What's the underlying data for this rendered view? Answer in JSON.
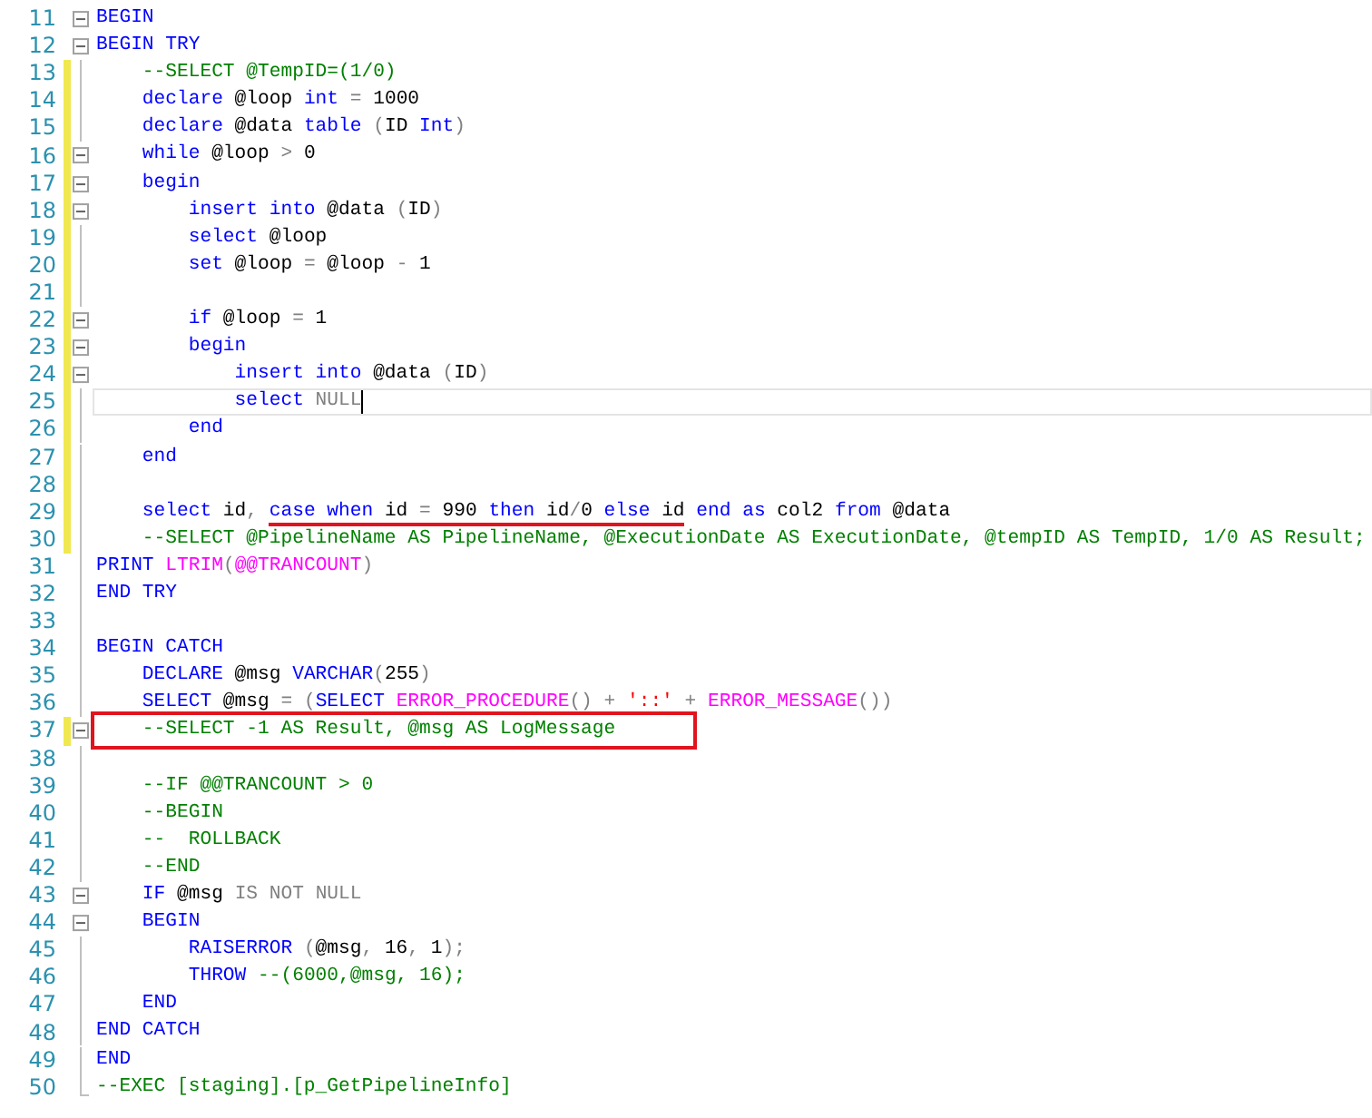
{
  "editor": {
    "lines": [
      {
        "number": "11",
        "changed": false,
        "kind": "start",
        "caret": false,
        "boxed": false,
        "tokens": [
          {
            "kind": "keyword",
            "text": "BEGIN"
          }
        ]
      },
      {
        "number": "12",
        "changed": false,
        "kind": "start",
        "caret": false,
        "boxed": false,
        "tokens": [
          {
            "kind": "keyword",
            "text": "BEGIN TRY"
          }
        ]
      },
      {
        "number": "13",
        "changed": true,
        "kind": "line",
        "caret": false,
        "boxed": false,
        "tokens": [
          {
            "kind": "comment",
            "text": "    --SELECT @TempID=(1/0)"
          }
        ]
      },
      {
        "number": "14",
        "changed": true,
        "kind": "line",
        "caret": false,
        "boxed": false,
        "tokens": [
          {
            "kind": "keyword",
            "text": "    declare"
          },
          {
            "kind": "plain",
            "text": " @loop "
          },
          {
            "kind": "keyword",
            "text": "int"
          },
          {
            "kind": "operator",
            "text": " ="
          },
          {
            "kind": "plain",
            "text": " 1000"
          }
        ]
      },
      {
        "number": "15",
        "changed": true,
        "kind": "line",
        "caret": false,
        "boxed": false,
        "tokens": [
          {
            "kind": "keyword",
            "text": "    declare"
          },
          {
            "kind": "plain",
            "text": " @data "
          },
          {
            "kind": "keyword",
            "text": "table "
          },
          {
            "kind": "operator",
            "text": "("
          },
          {
            "kind": "plain",
            "text": "ID "
          },
          {
            "kind": "keyword",
            "text": "Int"
          },
          {
            "kind": "operator",
            "text": ")"
          }
        ]
      },
      {
        "number": "16",
        "changed": true,
        "kind": "start",
        "caret": false,
        "boxed": false,
        "tokens": [
          {
            "kind": "keyword",
            "text": "    while"
          },
          {
            "kind": "plain",
            "text": " @loop "
          },
          {
            "kind": "operator",
            "text": ">"
          },
          {
            "kind": "plain",
            "text": " 0"
          }
        ]
      },
      {
        "number": "17",
        "changed": true,
        "kind": "start",
        "caret": false,
        "boxed": false,
        "tokens": [
          {
            "kind": "keyword",
            "text": "    begin"
          }
        ]
      },
      {
        "number": "18",
        "changed": true,
        "kind": "start",
        "caret": false,
        "boxed": false,
        "tokens": [
          {
            "kind": "keyword",
            "text": "        insert into"
          },
          {
            "kind": "plain",
            "text": " @data "
          },
          {
            "kind": "operator",
            "text": "("
          },
          {
            "kind": "plain",
            "text": "ID"
          },
          {
            "kind": "operator",
            "text": ")"
          }
        ]
      },
      {
        "number": "19",
        "changed": true,
        "kind": "line",
        "caret": false,
        "boxed": false,
        "tokens": [
          {
            "kind": "keyword",
            "text": "        select"
          },
          {
            "kind": "plain",
            "text": " @loop"
          }
        ]
      },
      {
        "number": "20",
        "changed": true,
        "kind": "line",
        "caret": false,
        "boxed": false,
        "tokens": [
          {
            "kind": "keyword",
            "text": "        set"
          },
          {
            "kind": "plain",
            "text": " @loop "
          },
          {
            "kind": "operator",
            "text": "="
          },
          {
            "kind": "plain",
            "text": " @loop "
          },
          {
            "kind": "operator",
            "text": "-"
          },
          {
            "kind": "plain",
            "text": " 1"
          }
        ]
      },
      {
        "number": "21",
        "changed": true,
        "kind": "line",
        "caret": false,
        "boxed": false
      },
      {
        "number": "22",
        "changed": true,
        "kind": "start",
        "caret": false,
        "boxed": false,
        "tokens": [
          {
            "kind": "keyword",
            "text": "        if"
          },
          {
            "kind": "plain",
            "text": " @loop "
          },
          {
            "kind": "operator",
            "text": "="
          },
          {
            "kind": "plain",
            "text": " 1"
          }
        ]
      },
      {
        "number": "23",
        "changed": true,
        "kind": "start",
        "caret": false,
        "boxed": false,
        "tokens": [
          {
            "kind": "keyword",
            "text": "        begin"
          }
        ]
      },
      {
        "number": "24",
        "changed": true,
        "kind": "start",
        "caret": false,
        "boxed": false,
        "tokens": [
          {
            "kind": "keyword",
            "text": "            insert into"
          },
          {
            "kind": "plain",
            "text": " @data "
          },
          {
            "kind": "operator",
            "text": "("
          },
          {
            "kind": "plain",
            "text": "ID"
          },
          {
            "kind": "operator",
            "text": ")"
          }
        ]
      },
      {
        "number": "25",
        "changed": true,
        "kind": "line",
        "caret": true,
        "boxed": false,
        "tokens": [
          {
            "kind": "keyword",
            "text": "            select"
          },
          {
            "kind": "operator",
            "text": " NULL"
          }
        ]
      },
      {
        "number": "26",
        "changed": true,
        "kind": "line",
        "caret": false,
        "boxed": false,
        "tokens": [
          {
            "kind": "keyword",
            "text": "        end"
          }
        ]
      },
      {
        "number": "27",
        "changed": true,
        "kind": "line",
        "caret": false,
        "boxed": false,
        "tokens": [
          {
            "kind": "keyword",
            "text": "    end"
          }
        ]
      },
      {
        "number": "28",
        "changed": true,
        "kind": "line",
        "caret": false,
        "boxed": false
      },
      {
        "number": "29",
        "changed": true,
        "kind": "line",
        "caret": false,
        "boxed": false,
        "tokens": [
          {
            "kind": "keyword",
            "text": "    select"
          },
          {
            "kind": "plain",
            "text": " id"
          },
          {
            "kind": "operator",
            "text": ", "
          },
          {
            "kind": "keyword",
            "text": "case when",
            "underlined": true
          },
          {
            "kind": "plain",
            "text": " id ",
            "underlined": true
          },
          {
            "kind": "operator",
            "text": "=",
            "underlined": true
          },
          {
            "kind": "plain",
            "text": " 990 ",
            "underlined": true
          },
          {
            "kind": "keyword",
            "text": "then",
            "underlined": true
          },
          {
            "kind": "plain",
            "text": " id",
            "underlined": true
          },
          {
            "kind": "operator",
            "text": "/",
            "underlined": true
          },
          {
            "kind": "plain",
            "text": "0 ",
            "underlined": true
          },
          {
            "kind": "keyword",
            "text": "else",
            "underlined": true
          },
          {
            "kind": "plain",
            "text": " id",
            "underlined": true
          },
          {
            "kind": "keyword",
            "text": " end as"
          },
          {
            "kind": "plain",
            "text": " col2 "
          },
          {
            "kind": "keyword",
            "text": "from"
          },
          {
            "kind": "plain",
            "text": " @data"
          }
        ]
      },
      {
        "number": "30",
        "changed": true,
        "kind": "line",
        "caret": false,
        "boxed": false,
        "tokens": [
          {
            "kind": "comment",
            "text": "    --SELECT @PipelineName AS PipelineName, @ExecutionDate AS ExecutionDate, @tempID AS TempID, 1/0 AS Result;"
          }
        ]
      },
      {
        "number": "31",
        "changed": false,
        "kind": "line",
        "caret": false,
        "boxed": false,
        "tokens": [
          {
            "kind": "keyword",
            "text": "PRINT "
          },
          {
            "kind": "function",
            "text": "LTRIM"
          },
          {
            "kind": "operator",
            "text": "("
          },
          {
            "kind": "function",
            "text": "@@TRANCOUNT"
          },
          {
            "kind": "operator",
            "text": ")"
          }
        ]
      },
      {
        "number": "32",
        "changed": false,
        "kind": "line",
        "caret": false,
        "boxed": false,
        "tokens": [
          {
            "kind": "keyword",
            "text": "END TRY"
          }
        ]
      },
      {
        "number": "33",
        "changed": false,
        "kind": "line",
        "caret": false,
        "boxed": false
      },
      {
        "number": "34",
        "changed": false,
        "kind": "line",
        "caret": false,
        "boxed": false,
        "tokens": [
          {
            "kind": "keyword",
            "text": "BEGIN CATCH"
          }
        ]
      },
      {
        "number": "35",
        "changed": false,
        "kind": "line",
        "caret": false,
        "boxed": false,
        "tokens": [
          {
            "kind": "keyword",
            "text": "    DECLARE"
          },
          {
            "kind": "plain",
            "text": " @msg "
          },
          {
            "kind": "keyword",
            "text": "VARCHAR"
          },
          {
            "kind": "operator",
            "text": "("
          },
          {
            "kind": "plain",
            "text": "255"
          },
          {
            "kind": "operator",
            "text": ")"
          }
        ]
      },
      {
        "number": "36",
        "changed": false,
        "kind": "line",
        "caret": false,
        "boxed": false,
        "tokens": [
          {
            "kind": "keyword",
            "text": "    SELECT"
          },
          {
            "kind": "plain",
            "text": " @msg "
          },
          {
            "kind": "operator",
            "text": "= ("
          },
          {
            "kind": "keyword",
            "text": "SELECT "
          },
          {
            "kind": "function",
            "text": "ERROR_PROCEDURE"
          },
          {
            "kind": "operator",
            "text": "() + "
          },
          {
            "kind": "string",
            "text": "'::'"
          },
          {
            "kind": "operator",
            "text": " + "
          },
          {
            "kind": "function",
            "text": "ERROR_MESSAGE"
          },
          {
            "kind": "operator",
            "text": "())"
          }
        ]
      },
      {
        "number": "37",
        "changed": true,
        "kind": "start",
        "caret": false,
        "boxed": true,
        "tokens": [
          {
            "kind": "comment",
            "text": "    --SELECT -1 AS Result, @msg AS LogMessage"
          }
        ]
      },
      {
        "number": "38",
        "changed": false,
        "kind": "line",
        "caret": false,
        "boxed": false
      },
      {
        "number": "39",
        "changed": false,
        "kind": "line",
        "caret": false,
        "boxed": false,
        "tokens": [
          {
            "kind": "comment",
            "text": "    --IF @@TRANCOUNT > 0"
          }
        ]
      },
      {
        "number": "40",
        "changed": false,
        "kind": "line",
        "caret": false,
        "boxed": false,
        "tokens": [
          {
            "kind": "comment",
            "text": "    --BEGIN"
          }
        ]
      },
      {
        "number": "41",
        "changed": false,
        "kind": "line",
        "caret": false,
        "boxed": false,
        "tokens": [
          {
            "kind": "comment",
            "text": "    --  ROLLBACK"
          }
        ]
      },
      {
        "number": "42",
        "changed": false,
        "kind": "line",
        "caret": false,
        "boxed": false,
        "tokens": [
          {
            "kind": "comment",
            "text": "    --END"
          }
        ]
      },
      {
        "number": "43",
        "changed": false,
        "kind": "start",
        "caret": false,
        "boxed": false,
        "tokens": [
          {
            "kind": "keyword",
            "text": "    IF"
          },
          {
            "kind": "plain",
            "text": " @msg "
          },
          {
            "kind": "operator",
            "text": "IS NOT NULL"
          }
        ]
      },
      {
        "number": "44",
        "changed": false,
        "kind": "start",
        "caret": false,
        "boxed": false,
        "tokens": [
          {
            "kind": "keyword",
            "text": "    BEGIN"
          }
        ]
      },
      {
        "number": "45",
        "changed": false,
        "kind": "line",
        "caret": false,
        "boxed": false,
        "tokens": [
          {
            "kind": "keyword",
            "text": "        RAISERROR "
          },
          {
            "kind": "operator",
            "text": "("
          },
          {
            "kind": "plain",
            "text": "@msg"
          },
          {
            "kind": "operator",
            "text": ", "
          },
          {
            "kind": "plain",
            "text": "16"
          },
          {
            "kind": "operator",
            "text": ", "
          },
          {
            "kind": "plain",
            "text": "1"
          },
          {
            "kind": "operator",
            "text": ");"
          }
        ]
      },
      {
        "number": "46",
        "changed": false,
        "kind": "line",
        "caret": false,
        "boxed": false,
        "tokens": [
          {
            "kind": "keyword",
            "text": "        THROW "
          },
          {
            "kind": "comment",
            "text": "--(6000,@msg, 16);"
          }
        ]
      },
      {
        "number": "47",
        "changed": false,
        "kind": "line",
        "caret": false,
        "boxed": false,
        "tokens": [
          {
            "kind": "keyword",
            "text": "    END"
          }
        ]
      },
      {
        "number": "48",
        "changed": false,
        "kind": "line",
        "caret": false,
        "boxed": false,
        "tokens": [
          {
            "kind": "keyword",
            "text": "END CATCH"
          }
        ]
      },
      {
        "number": "49",
        "changed": false,
        "kind": "line",
        "caret": false,
        "boxed": false,
        "tokens": [
          {
            "kind": "keyword",
            "text": "END"
          }
        ]
      },
      {
        "number": "50",
        "changed": false,
        "kind": "end",
        "caret": false,
        "boxed": false,
        "tokens": [
          {
            "kind": "comment",
            "text": "--EXEC [staging].[p_GetPipelineInfo]"
          }
        ]
      }
    ]
  }
}
